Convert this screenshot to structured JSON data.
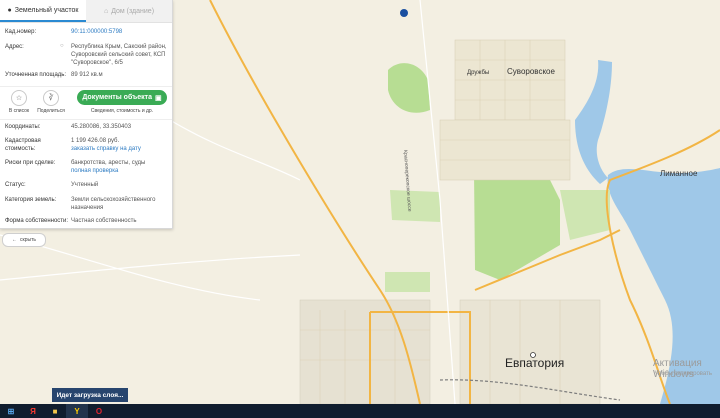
{
  "tabs": [
    {
      "label": "Земельный участок",
      "active": true
    },
    {
      "label": "Дом (здание)",
      "active": false
    }
  ],
  "info": {
    "cadastral_number": {
      "label": "Кад.номер:",
      "value": "90:11:000000:5798"
    },
    "address": {
      "label": "Адрес:",
      "value": "Республика Крым, Сакский район, Суворовский сельский совет, КСП \"Суворовское\", 6/5"
    },
    "area": {
      "label": "Уточненная площадь:",
      "value": "89 912 кв.м"
    }
  },
  "actions": {
    "to_list": "В список",
    "share": "Поделиться",
    "documents_button": "Документы объекта",
    "documents_sub": "Сведения, стоимость и др."
  },
  "details": {
    "coordinates": {
      "label": "Координаты:",
      "value": "45.280086, 33.350403"
    },
    "cadastral_value": {
      "label": "Кадастровая стоимость:",
      "value": "1 199 426.08 руб.",
      "link": "заказать справку на дату"
    },
    "risks": {
      "label": "Риски при сделке:",
      "value": "банкротства, аресты, суды",
      "link": "полная проверка"
    },
    "status": {
      "label": "Статус:",
      "value": "Учтенный"
    },
    "category": {
      "label": "Категория земель:",
      "value": "Земли сельскохозяйственного назначения"
    },
    "ownership": {
      "label": "Форма собственности:",
      "value": "Частная собственность"
    }
  },
  "hide_button": "скрыть",
  "map_labels": {
    "suvorovskoe": "Суворовское",
    "druzhby": "Дружбы",
    "limannoe": "Лиманное",
    "evpatoria": "Евпатория",
    "krasnoperekopskoe": "Красноперекопское шоссе",
    "activation": "Активация Windows",
    "activation_sub": "Чтобы активировать"
  },
  "loading": "Идет загрузка слоя...",
  "colors": {
    "link": "#2e7cc3",
    "button": "#3aab55",
    "water": "#9fc8e8",
    "greenery": "#b7dd93",
    "road": "#f2b544",
    "parcel": "#1a4fa0"
  },
  "taskbar_icons": [
    "windows-icon",
    "yandex-icon",
    "folder-icon",
    "yandex-browser-icon",
    "opera-icon"
  ]
}
